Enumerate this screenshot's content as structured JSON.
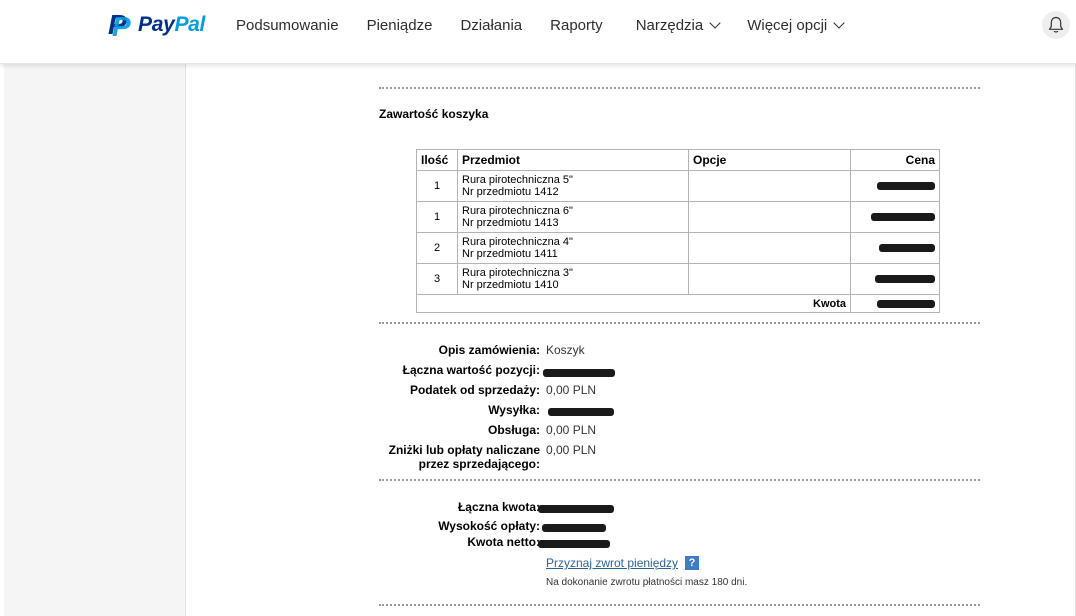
{
  "brand": {
    "pay": "Pay",
    "pal": "Pal",
    "mark": "P"
  },
  "nav": {
    "items": [
      "Podsumowanie",
      "Pieniądze",
      "Działania",
      "Raporty",
      "Narzędzia",
      "Więcej opcji"
    ]
  },
  "cart": {
    "title": "Zawartość koszyka",
    "headers": {
      "qty": "Ilość",
      "item": "Przedmiot",
      "options": "Opcje",
      "price": "Cena"
    },
    "rows": [
      {
        "qty": "1",
        "name": "Rura pirotechniczna 5\"",
        "number": "Nr przedmiotu 1412",
        "options": "",
        "price": "[redacted]"
      },
      {
        "qty": "1",
        "name": "Rura pirotechniczna 6\"",
        "number": "Nr przedmiotu 1413",
        "options": "",
        "price": "[redacted]"
      },
      {
        "qty": "2",
        "name": "Rura pirotechniczna 4\"",
        "number": "Nr przedmiotu 1411",
        "options": "",
        "price": "[redacted]"
      },
      {
        "qty": "3",
        "name": "Rura pirotechniczna 3\"",
        "number": "Nr przedmiotu 1410",
        "options": "",
        "price": "[redacted]"
      }
    ],
    "total_label": "Kwota",
    "total_value": "[redacted]"
  },
  "summary": {
    "order_desc_label": "Opis zamówienia:",
    "order_desc_value": "Koszyk",
    "items_total_label": "Łączna wartość pozycji:",
    "items_total_value": "[redacted]",
    "tax_label": "Podatek od sprzedaży:",
    "tax_value": "0,00 PLN",
    "shipping_label": "Wysyłka:",
    "shipping_value": "[redacted]",
    "handling_label": "Obsługa:",
    "handling_value": "0,00 PLN",
    "discounts_label_1": "Zniżki lub opłaty naliczane",
    "discounts_label_2": "przez sprzedającego:",
    "discounts_value": "0,00 PLN"
  },
  "totals": {
    "gross_label": "Łączna kwota:",
    "gross_value": "[redacted]",
    "fee_label": "Wysokość opłaty:",
    "fee_value": "[redacted]",
    "net_label": "Kwota netto:",
    "net_value": "[redacted]"
  },
  "refund": {
    "link": "Przyznaj zwrot pieniędzy",
    "help": "?",
    "note": "Na dokonanie zwrotu płatności masz 180 dni."
  }
}
